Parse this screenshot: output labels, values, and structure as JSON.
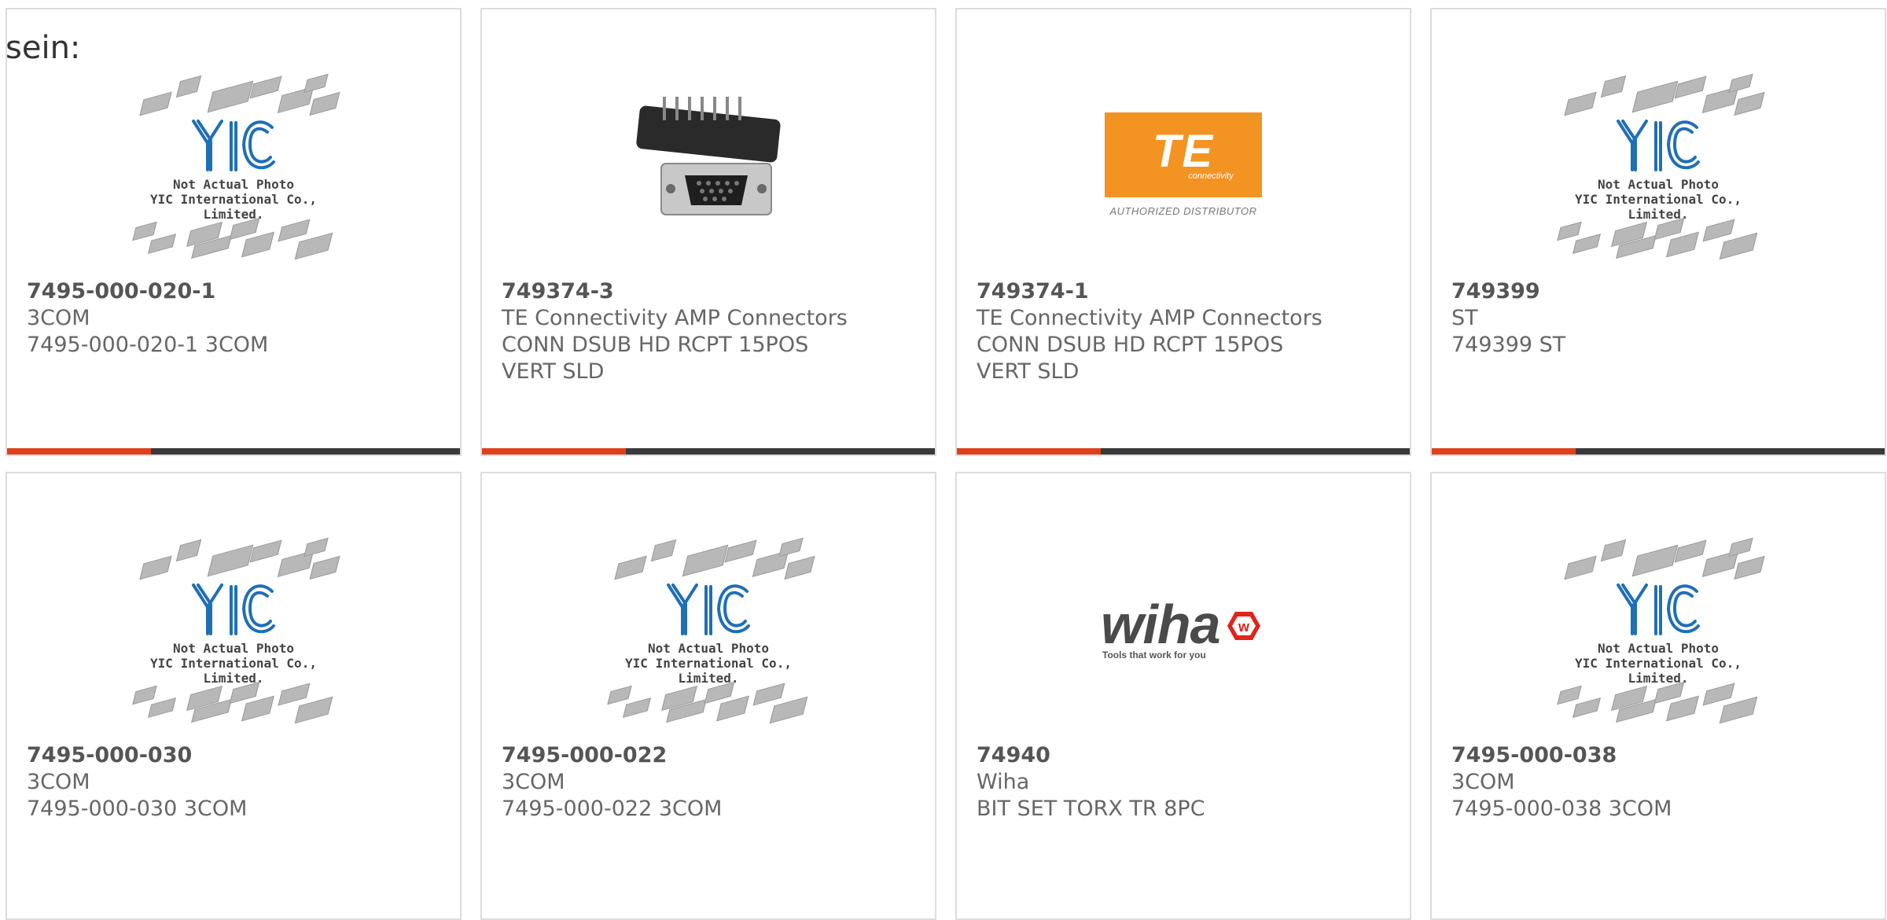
{
  "heading": "sein:",
  "products": [
    {
      "part": "7495-000-020-1",
      "manufacturer": "3COM",
      "description": "7495-000-020-1 3COM",
      "image": "placeholder"
    },
    {
      "part": "749374-3",
      "manufacturer": "TE Connectivity AMP Connectors",
      "description": "CONN DSUB HD RCPT 15POS VERT SLD",
      "image": "dsub-connector-photo"
    },
    {
      "part": "749374-1",
      "manufacturer": "TE Connectivity AMP Connectors",
      "description": "CONN DSUB HD RCPT 15POS VERT SLD",
      "image": "te-logo"
    },
    {
      "part": "749399",
      "manufacturer": "ST",
      "description": "749399 ST",
      "image": "placeholder"
    },
    {
      "part": "7495-000-030",
      "manufacturer": "3COM",
      "description": "7495-000-030 3COM",
      "image": "placeholder"
    },
    {
      "part": "7495-000-022",
      "manufacturer": "3COM",
      "description": "7495-000-022 3COM",
      "image": "placeholder"
    },
    {
      "part": "74940",
      "manufacturer": "Wiha",
      "description": "BIT SET TORX TR 8PC",
      "image": "wiha-logo"
    },
    {
      "part": "7495-000-038",
      "manufacturer": "3COM",
      "description": "7495-000-038 3COM",
      "image": "placeholder"
    }
  ],
  "placeholder": {
    "logo_text": "YIC",
    "line1": "Not Actual Photo",
    "line2": "YIC International Co., Limited."
  },
  "te_logo": {
    "mark": "TE",
    "sub": "connectivity",
    "authorized": "AUTHORIZED DISTRIBUTOR"
  },
  "wiha_logo": {
    "word": "wiha",
    "tagline": "Tools that work for you"
  },
  "colors": {
    "accent": "#e0401c",
    "bar": "#3a3a3a",
    "te_orange": "#f39322",
    "yic_blue": "#1f6fb5"
  }
}
